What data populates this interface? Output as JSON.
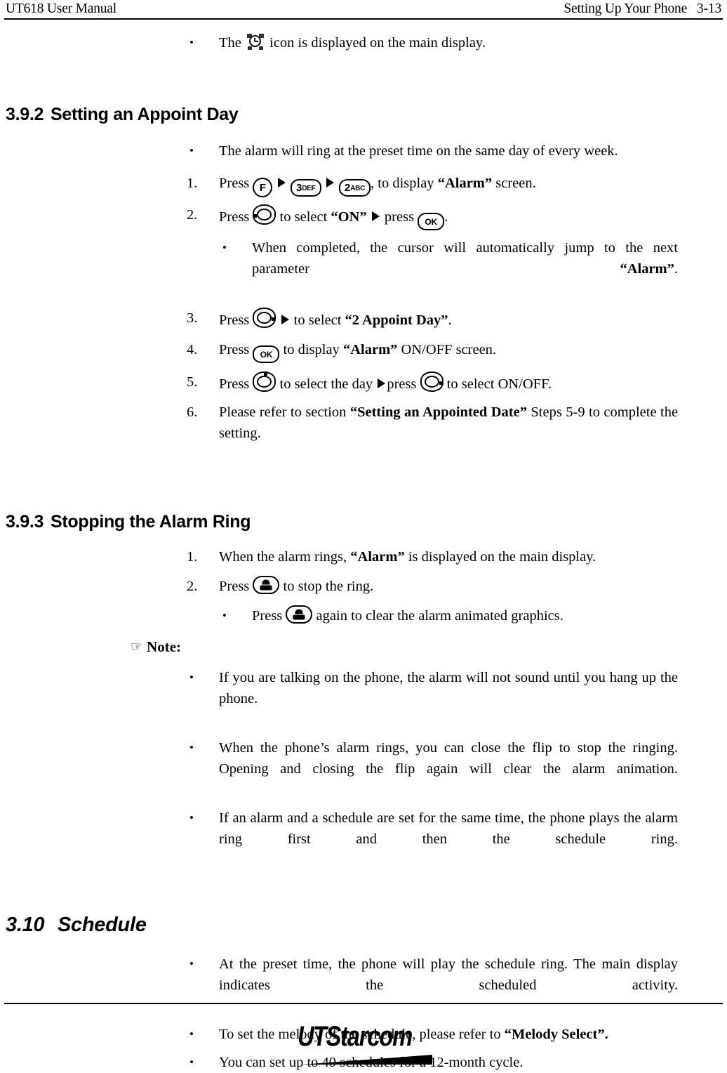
{
  "header": {
    "left": "UT618 User Manual",
    "right_title": "Setting Up Your Phone",
    "page_number": "3-13"
  },
  "icons": {
    "alarm_clock": "alarm-clock-icon",
    "hand_pointer": "☞",
    "key_f": "F",
    "key_3_digit": "3",
    "key_3_letters": "DEF",
    "key_2_digit": "2",
    "key_2_letters": "ABC",
    "key_ok": "OK",
    "key_nav": "navigation-rocker-key",
    "key_end_call": "end-call-key",
    "arrow": "right-triangle-arrow"
  },
  "intro_bullet": {
    "before_icon": "The",
    "after_icon": "icon is displayed on the main display."
  },
  "section_392": {
    "number": "3.9.2",
    "title": "Setting an Appoint Day",
    "lead_bullet": "The alarm will ring at the preset time on the same day of every week.",
    "steps": [
      {
        "marker": "1.",
        "text_start": "Press",
        "text_mid": ", to display",
        "bold_1": "“Alarm”",
        "text_end": "screen."
      },
      {
        "marker": "2.",
        "text_start": "Press",
        "text_mid": "to select",
        "bold_1": "“ON”",
        "text_mid2": "press",
        "text_end": "."
      },
      {
        "marker": "3.",
        "text_start": "Press",
        "text_mid": "to select",
        "bold_1": "“2 Appoint Day”",
        "text_end": "."
      },
      {
        "marker": "4.",
        "text_start": "Press",
        "text_mid": "to display",
        "bold_1": "“Alarm”",
        "text_end": "ON/OFF screen."
      },
      {
        "marker": "5.",
        "text_start": "Press",
        "text_mid": "to select the day",
        "text_mid2": "press",
        "text_end": "to select ON/OFF."
      },
      {
        "marker": "6.",
        "text_start": "Please refer to section",
        "bold_1": "“Setting an Appointed Date”",
        "text_end": "Steps 5-9 to complete the setting."
      }
    ],
    "sub_bullet": {
      "text_start": "When completed, the cursor will automatically jump to the next parameter",
      "bold_1": "“Alarm”",
      "text_end": "."
    }
  },
  "section_393": {
    "number": "3.9.3",
    "title": "Stopping the Alarm Ring",
    "steps": [
      {
        "marker": "1.",
        "text_start": "When the alarm rings,",
        "bold_1": "“Alarm”",
        "text_end": "is displayed on the main display."
      },
      {
        "marker": "2.",
        "text_start": "Press",
        "text_end": "to stop the ring."
      }
    ],
    "sub_bullet": {
      "text_start": "Press",
      "text_end": "again to clear the alarm animated graphics."
    },
    "note_label": "Note:",
    "notes": [
      "If you are talking on the phone, the alarm will not sound until you hang up the phone.",
      "When the phone’s alarm rings, you can close the flip to stop the ringing. Opening and closing the flip again will clear the alarm animation.",
      "If an alarm and a schedule are set for the same time, the phone plays the alarm ring first and then the schedule ring."
    ]
  },
  "section_310": {
    "number": "3.10",
    "title": "Schedule",
    "bullets": [
      {
        "text_start": "At the preset time, the phone will play the schedule ring. The main display indicates the scheduled activity."
      },
      {
        "text_start": "To set the melody of the schedule, please refer to",
        "bold_1": "“Melody Select”."
      },
      {
        "text_start": "You can set up to 40 schedules for a 12-month cycle."
      }
    ]
  },
  "footer": {
    "logo_ut": "UT",
    "logo_starcom": "Starcom"
  }
}
